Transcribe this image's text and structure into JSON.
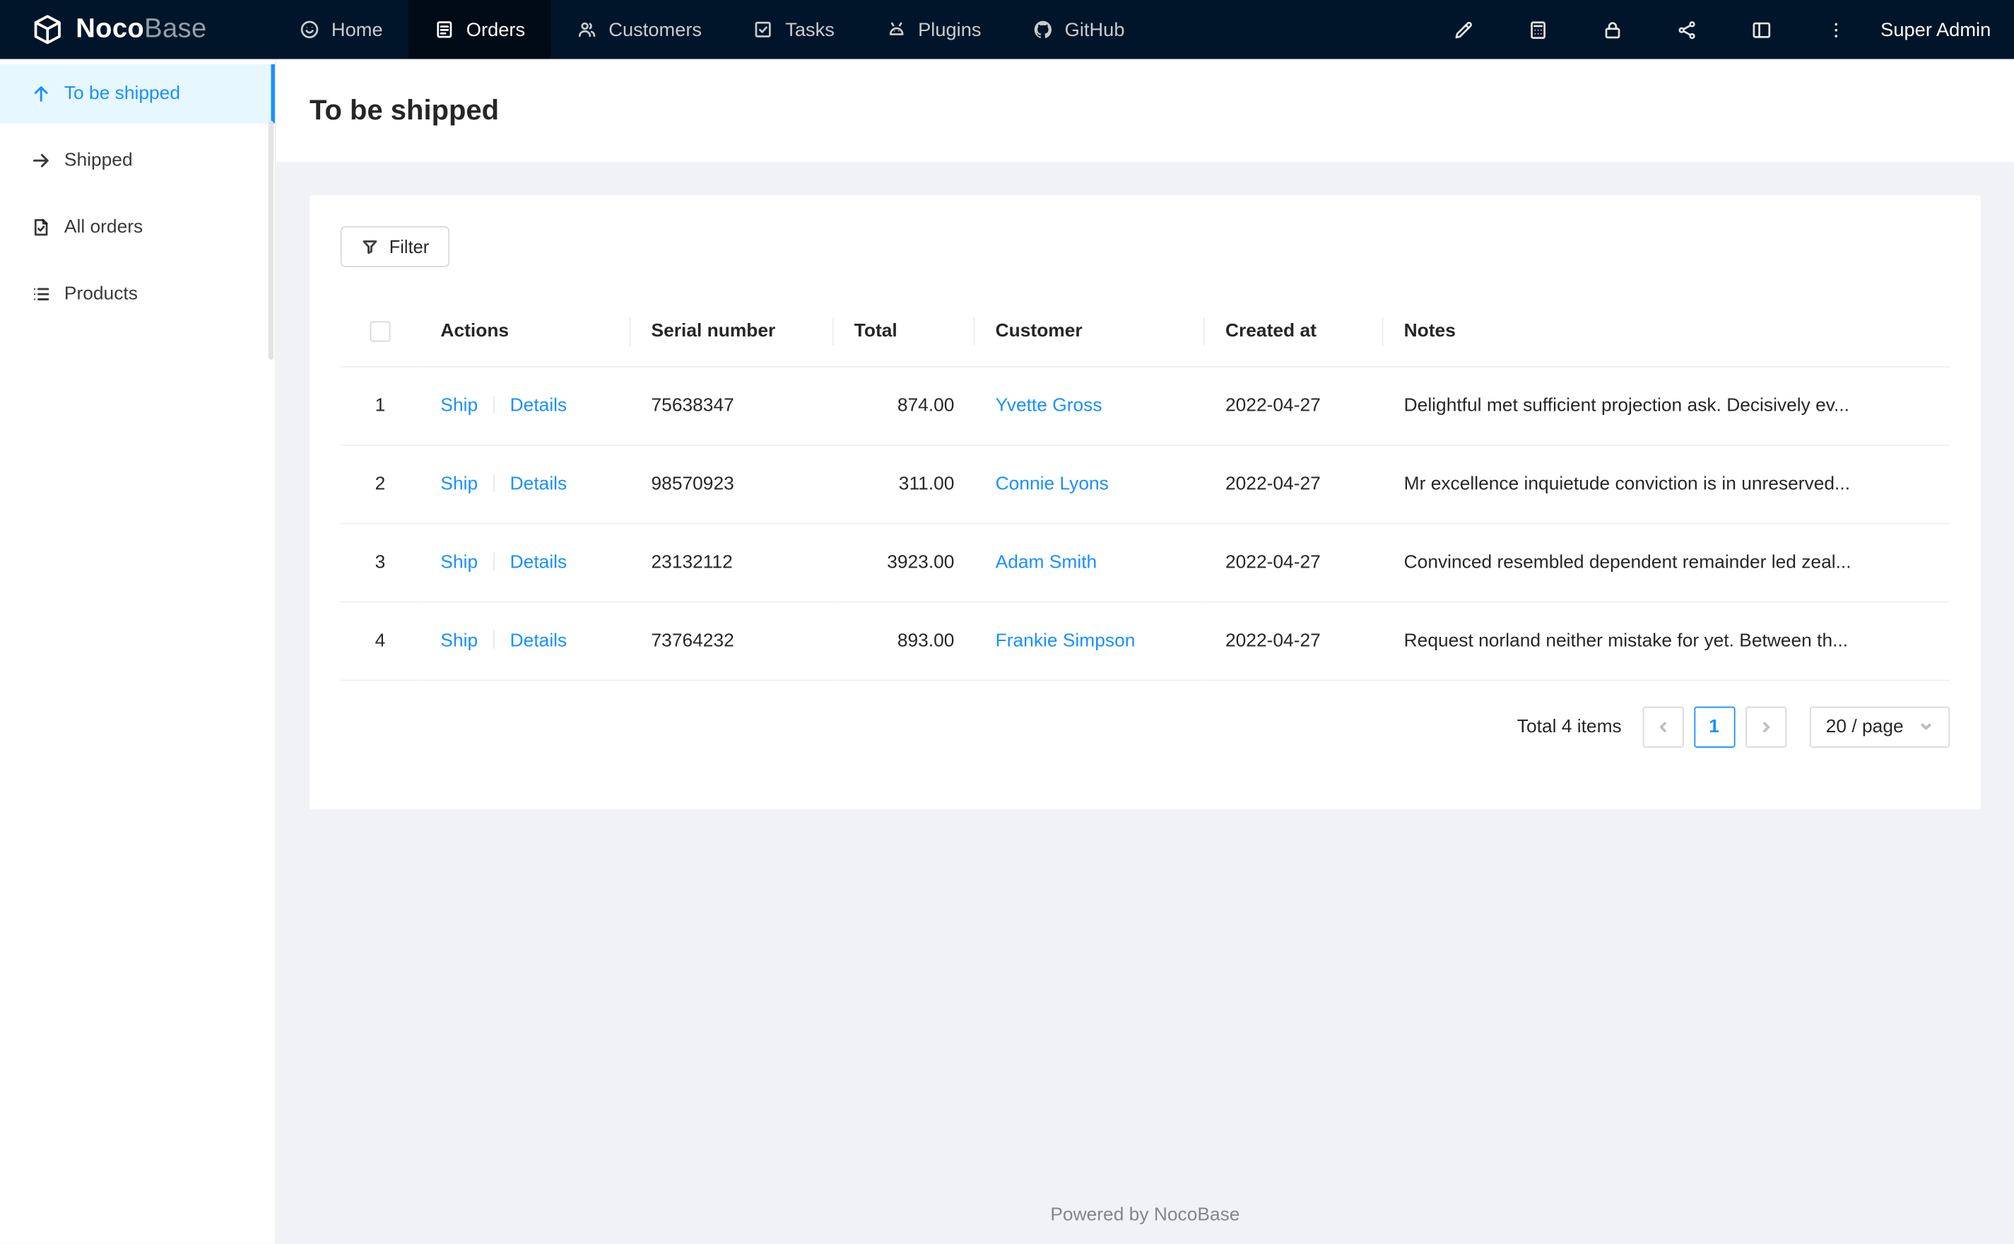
{
  "colors": {
    "accent": "#1890ff",
    "navbar_bg": "#001529",
    "sidebar_active_bg": "#e6f7ff"
  },
  "navbar": {
    "logo_bold": "Noco",
    "logo_light": "Base",
    "items": [
      {
        "label": "Home"
      },
      {
        "label": "Orders"
      },
      {
        "label": "Customers"
      },
      {
        "label": "Tasks"
      },
      {
        "label": "Plugins"
      },
      {
        "label": "GitHub"
      }
    ],
    "user": "Super Admin"
  },
  "sidebar": {
    "items": [
      {
        "label": "To be shipped"
      },
      {
        "label": "Shipped"
      },
      {
        "label": "All orders"
      },
      {
        "label": "Products"
      }
    ]
  },
  "page": {
    "title": "To be shipped"
  },
  "toolbar": {
    "filter_label": "Filter"
  },
  "table": {
    "headers": {
      "actions": "Actions",
      "serial": "Serial number",
      "total": "Total",
      "customer": "Customer",
      "created": "Created at",
      "notes": "Notes"
    },
    "action_labels": {
      "ship": "Ship",
      "details": "Details"
    },
    "rows": [
      {
        "index": "1",
        "serial": "75638347",
        "total": "874.00",
        "customer": "Yvette Gross",
        "created": "2022-04-27",
        "notes": "Delightful met sufficient projection ask. Decisively ev..."
      },
      {
        "index": "2",
        "serial": "98570923",
        "total": "311.00",
        "customer": "Connie Lyons",
        "created": "2022-04-27",
        "notes": "Mr excellence inquietude conviction is in unreserved..."
      },
      {
        "index": "3",
        "serial": "23132112",
        "total": "3923.00",
        "customer": "Adam Smith",
        "created": "2022-04-27",
        "notes": "Convinced resembled dependent remainder led zeal..."
      },
      {
        "index": "4",
        "serial": "73764232",
        "total": "893.00",
        "customer": "Frankie Simpson",
        "created": "2022-04-27",
        "notes": "Request norland neither mistake for yet. Between th..."
      }
    ]
  },
  "pagination": {
    "total_text": "Total 4 items",
    "current_page": "1",
    "page_size_label": "20 / page"
  },
  "footer": {
    "text": "Powered by NocoBase"
  }
}
